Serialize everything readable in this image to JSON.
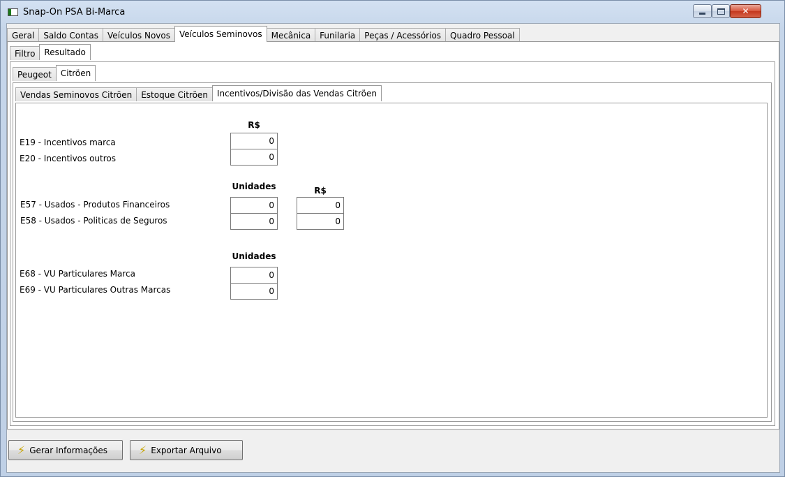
{
  "window": {
    "title": "Snap-On PSA Bi-Marca",
    "close_glyph": "✕"
  },
  "main_tabs": [
    "Geral",
    "Saldo Contas",
    "Veículos Novos",
    "Veículos Seminovos",
    "Mecânica",
    "Funilaria",
    "Peças / Acessórios",
    "Quadro Pessoal"
  ],
  "main_tab_active": "Veículos Seminovos",
  "sub_tabs": [
    "Filtro",
    "Resultado"
  ],
  "brand_tabs": [
    "Peugeot",
    "Citröen"
  ],
  "report_tabs": [
    "Vendas Seminovos Citröen",
    "Estoque Citröen",
    "Incentivos/Divisão das Vendas Citröen"
  ],
  "section1": {
    "header": "R$",
    "rows": [
      {
        "label": "E19 - Incentivos marca",
        "value": "0"
      },
      {
        "label": "E20 - Incentivos outros",
        "value": "0"
      }
    ]
  },
  "section2": {
    "header_units": "Unidades",
    "header_value": "R$",
    "rows": [
      {
        "label": "E57 - Usados - Produtos Financeiros",
        "units": "0",
        "value": "0"
      },
      {
        "label": "E58 - Usados - Politicas de Seguros",
        "units": "0",
        "value": "0"
      }
    ]
  },
  "section3": {
    "header": "Unidades",
    "rows": [
      {
        "label": "E68 - VU Particulares Marca",
        "value": "0"
      },
      {
        "label": "E69 - VU Particulares Outras Marcas",
        "value": "0"
      }
    ]
  },
  "buttons": {
    "generate": "Gerar Informações",
    "export": "Exportar Arquivo"
  },
  "icons": {
    "button_icon": "lightning-bolt-icon"
  }
}
